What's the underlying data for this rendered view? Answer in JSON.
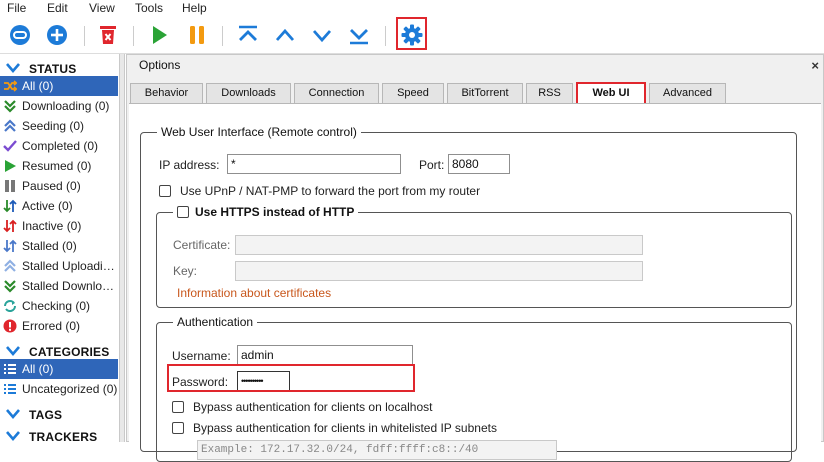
{
  "menu": [
    "File",
    "Edit",
    "View",
    "Tools",
    "Help"
  ],
  "toolbar": {
    "icons": [
      "add-link-icon",
      "add-file-icon",
      "delete-icon",
      "resume-icon",
      "pause-icon",
      "move-top-icon",
      "move-up-icon",
      "move-down-icon",
      "move-bottom-icon",
      "settings-icon"
    ],
    "accent": "#1d7bd8"
  },
  "sidebar": {
    "status_title": "STATUS",
    "status_items": [
      {
        "label": "All (0)",
        "icon": "all-icon",
        "selected": true
      },
      {
        "label": "Downloading (0)",
        "icon": "downloading-icon"
      },
      {
        "label": "Seeding (0)",
        "icon": "seeding-icon"
      },
      {
        "label": "Completed (0)",
        "icon": "completed-icon"
      },
      {
        "label": "Resumed (0)",
        "icon": "resumed-icon"
      },
      {
        "label": "Paused (0)",
        "icon": "paused-icon"
      },
      {
        "label": "Active (0)",
        "icon": "active-icon"
      },
      {
        "label": "Inactive (0)",
        "icon": "inactive-icon"
      },
      {
        "label": "Stalled (0)",
        "icon": "stalled-icon"
      },
      {
        "label": "Stalled Uploadi…",
        "icon": "stalled-uploading-icon"
      },
      {
        "label": "Stalled Downlo…",
        "icon": "stalled-downloading-icon"
      },
      {
        "label": "Checking (0)",
        "icon": "checking-icon"
      },
      {
        "label": "Errored (0)",
        "icon": "errored-icon"
      }
    ],
    "categories_title": "CATEGORIES",
    "category_items": [
      {
        "label": "All (0)",
        "selected": true
      },
      {
        "label": "Uncategorized (0)"
      }
    ],
    "tags_title": "TAGS",
    "trackers_title": "TRACKERS",
    "selected_color": "#2f66b9"
  },
  "dialog": {
    "title": "Options",
    "close": "×",
    "tabs": [
      "Behavior",
      "Downloads",
      "Connection",
      "Speed",
      "BitTorrent",
      "RSS",
      "Web UI",
      "Advanced"
    ],
    "active_tab": "Web UI",
    "webui": {
      "legend": "Web User Interface (Remote control)",
      "ip_label": "IP address:",
      "ip_value": "*",
      "port_label": "Port:",
      "port_value": "8080",
      "upnp_label": "Use UPnP / NAT-PMP to forward the port from my router"
    },
    "https": {
      "legend": "Use HTTPS instead of HTTP",
      "certificate_label": "Certificate:",
      "key_label": "Key:",
      "info_link": "Information about certificates"
    },
    "auth": {
      "legend": "Authentication",
      "username_label": "Username:",
      "username_value": "admin",
      "password_label": "Password:",
      "password_value": "••••••••••",
      "bypass_localhost": "Bypass authentication for clients on localhost",
      "bypass_whitelist": "Bypass authentication for clients in whitelisted IP subnets",
      "whitelist_placeholder": "Example: 172.17.32.0/24, fdff:ffff:c8::/40"
    },
    "highlight_color": "#e0262d"
  }
}
